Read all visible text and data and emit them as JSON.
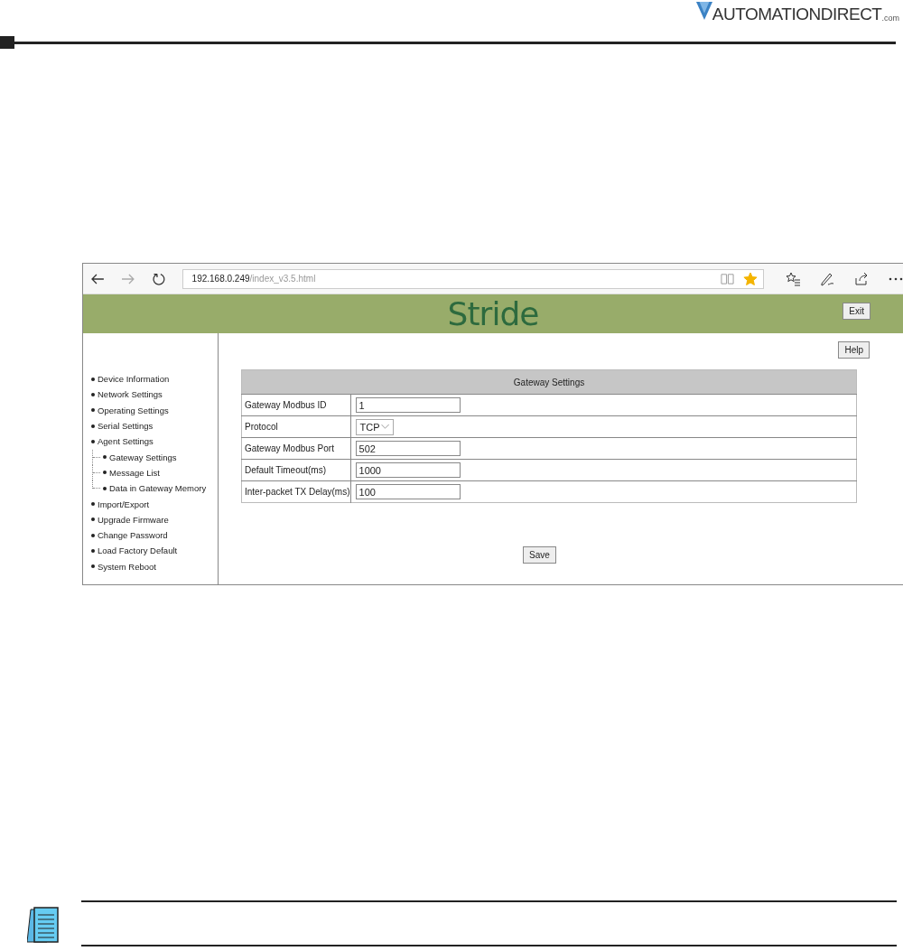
{
  "brand": {
    "name": "AUTOMATIONDIRECT",
    "suffix": ".com"
  },
  "browser": {
    "url_host": "192.168.0.249",
    "url_path": "/index_v3.5.html",
    "favorite": true
  },
  "app": {
    "logo": "Stride",
    "exit_button": "Exit",
    "help_button": "Help",
    "save_button": "Save",
    "sidebar": {
      "items": [
        {
          "label": "Device Information"
        },
        {
          "label": "Network Settings"
        },
        {
          "label": "Operating Settings"
        },
        {
          "label": "Serial Settings"
        },
        {
          "label": "Agent Settings",
          "children": [
            {
              "label": "Gateway Settings"
            },
            {
              "label": "Message List"
            },
            {
              "label": "Data in Gateway Memory"
            }
          ]
        },
        {
          "label": "Import/Export"
        },
        {
          "label": "Upgrade Firmware"
        },
        {
          "label": "Change Password"
        },
        {
          "label": "Load Factory Default"
        },
        {
          "label": "System Reboot"
        }
      ]
    },
    "settings_table": {
      "title": "Gateway Settings",
      "rows": [
        {
          "label": "Gateway Modbus ID",
          "kind": "input",
          "value": "1"
        },
        {
          "label": "Protocol",
          "kind": "select",
          "value": "TCP"
        },
        {
          "label": "Gateway Modbus Port",
          "kind": "input",
          "value": "502"
        },
        {
          "label": "Default Timeout(ms)",
          "kind": "input",
          "value": "1000"
        },
        {
          "label": "Inter-packet TX Delay(ms)",
          "kind": "input",
          "value": "100"
        }
      ]
    }
  }
}
